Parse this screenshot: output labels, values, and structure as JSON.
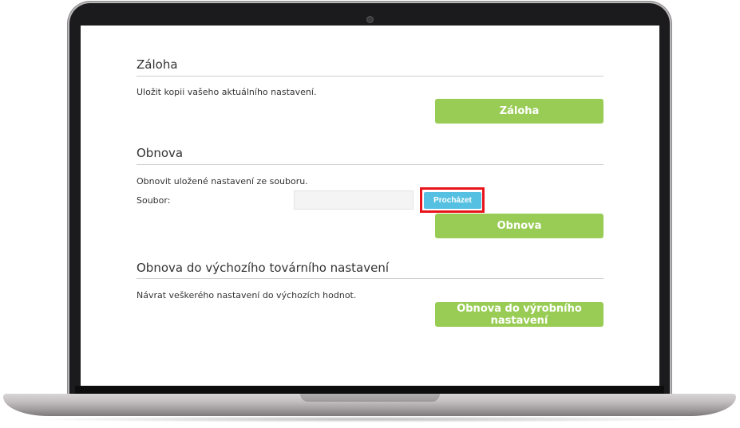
{
  "backup": {
    "title": "Záloha",
    "description": "Uložit kopii vašeho aktuálního nastavení.",
    "button_label": "Záloha"
  },
  "restore": {
    "title": "Obnova",
    "description": "Obnovit uložené nastavení ze souboru.",
    "file_label": "Soubor:",
    "file_value": "",
    "browse_label": "Procházet",
    "button_label": "Obnova"
  },
  "factory": {
    "title": "Obnova do výchozího továrního nastavení",
    "description": "Návrat veškerého nastavení do výchozích hodnot.",
    "button_label": "Obnova do výrobního nastavení"
  },
  "colors": {
    "primary_button": "#99cc55",
    "browse_button": "#55c0e2",
    "highlight": "#e8141c"
  }
}
